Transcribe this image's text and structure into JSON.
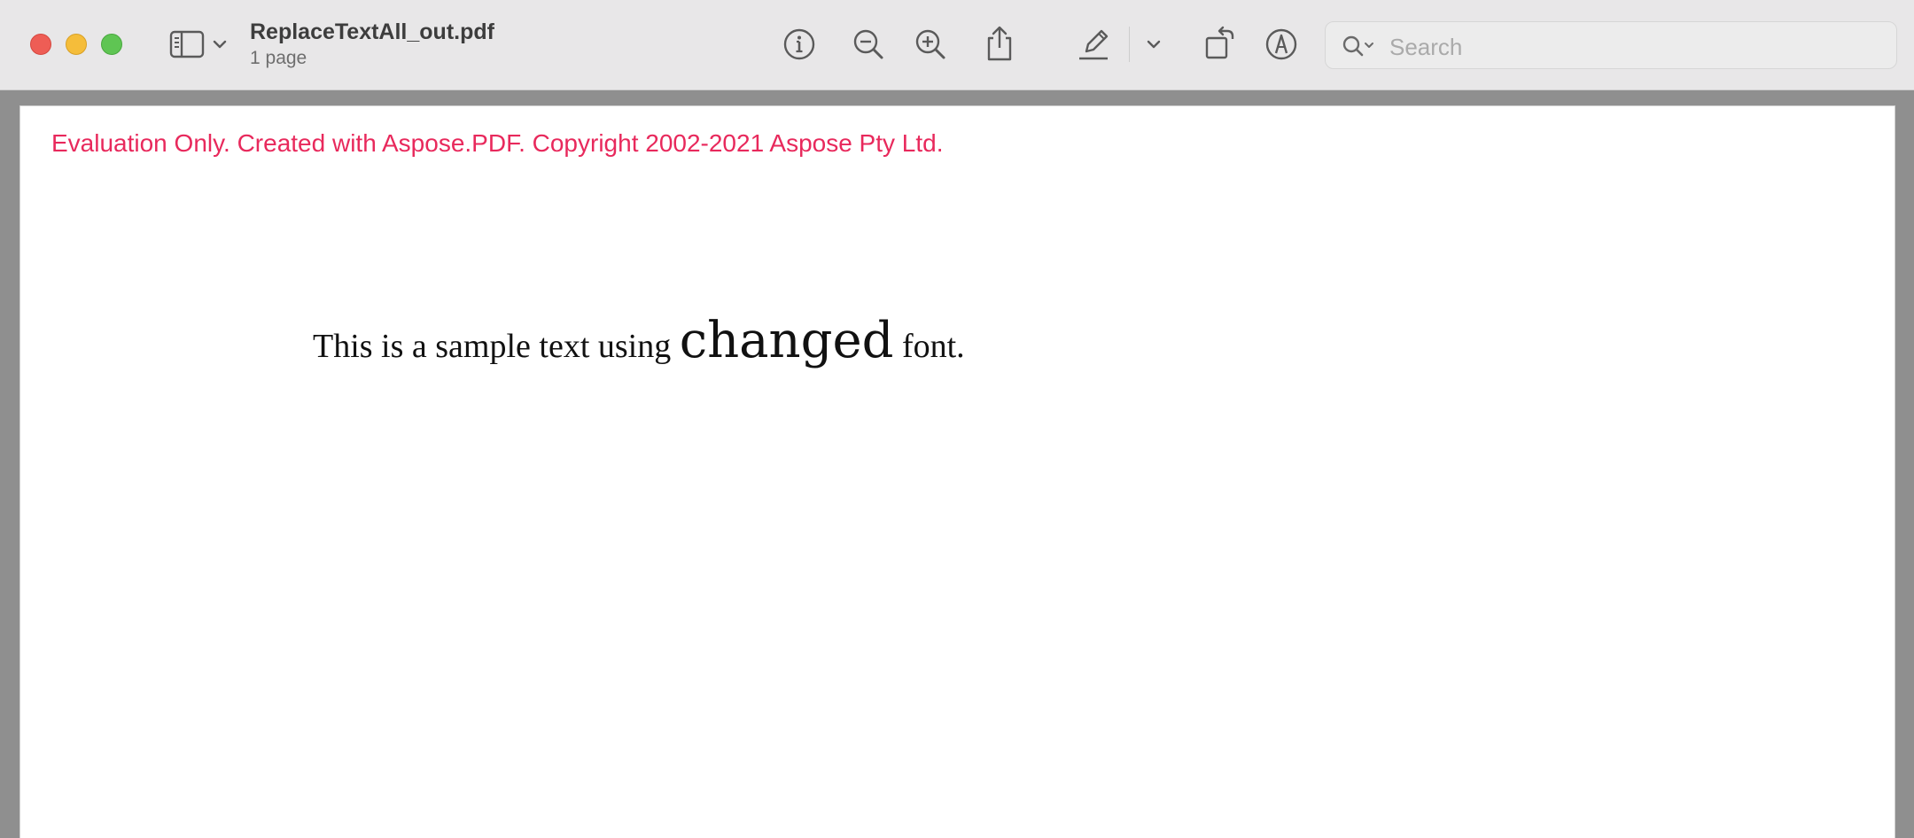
{
  "window": {
    "traffic_lights": [
      "close",
      "minimize",
      "maximize"
    ]
  },
  "toolbar": {
    "document_title": "ReplaceTextAll_out.pdf",
    "document_subtitle": "1 page",
    "icons": {
      "sidebar": "sidebar-icon",
      "sidebar_menu": "chevron-down-icon",
      "info": "info-icon",
      "zoom_out": "zoom-out-icon",
      "zoom_in": "zoom-in-icon",
      "share": "share-icon",
      "highlight": "pencil-icon",
      "highlight_menu": "chevron-down-icon",
      "rotate": "rotate-icon",
      "markup": "markup-icon"
    },
    "search": {
      "placeholder": "Search",
      "value": ""
    }
  },
  "document": {
    "watermark": "Evaluation Only. Created with Aspose.PDF. Copyright 2002-2021 Aspose Pty Ltd.",
    "sample_before": "This is a sample text using ",
    "sample_changed": "changed",
    "sample_after": " font."
  },
  "colors": {
    "toolbar_bg": "#e8e7e8",
    "close": "#ee5d55",
    "minimize": "#f5bd3a",
    "maximize": "#5fc553",
    "watermark": "#e8295c",
    "canvas_bg": "#8f8f8f"
  }
}
